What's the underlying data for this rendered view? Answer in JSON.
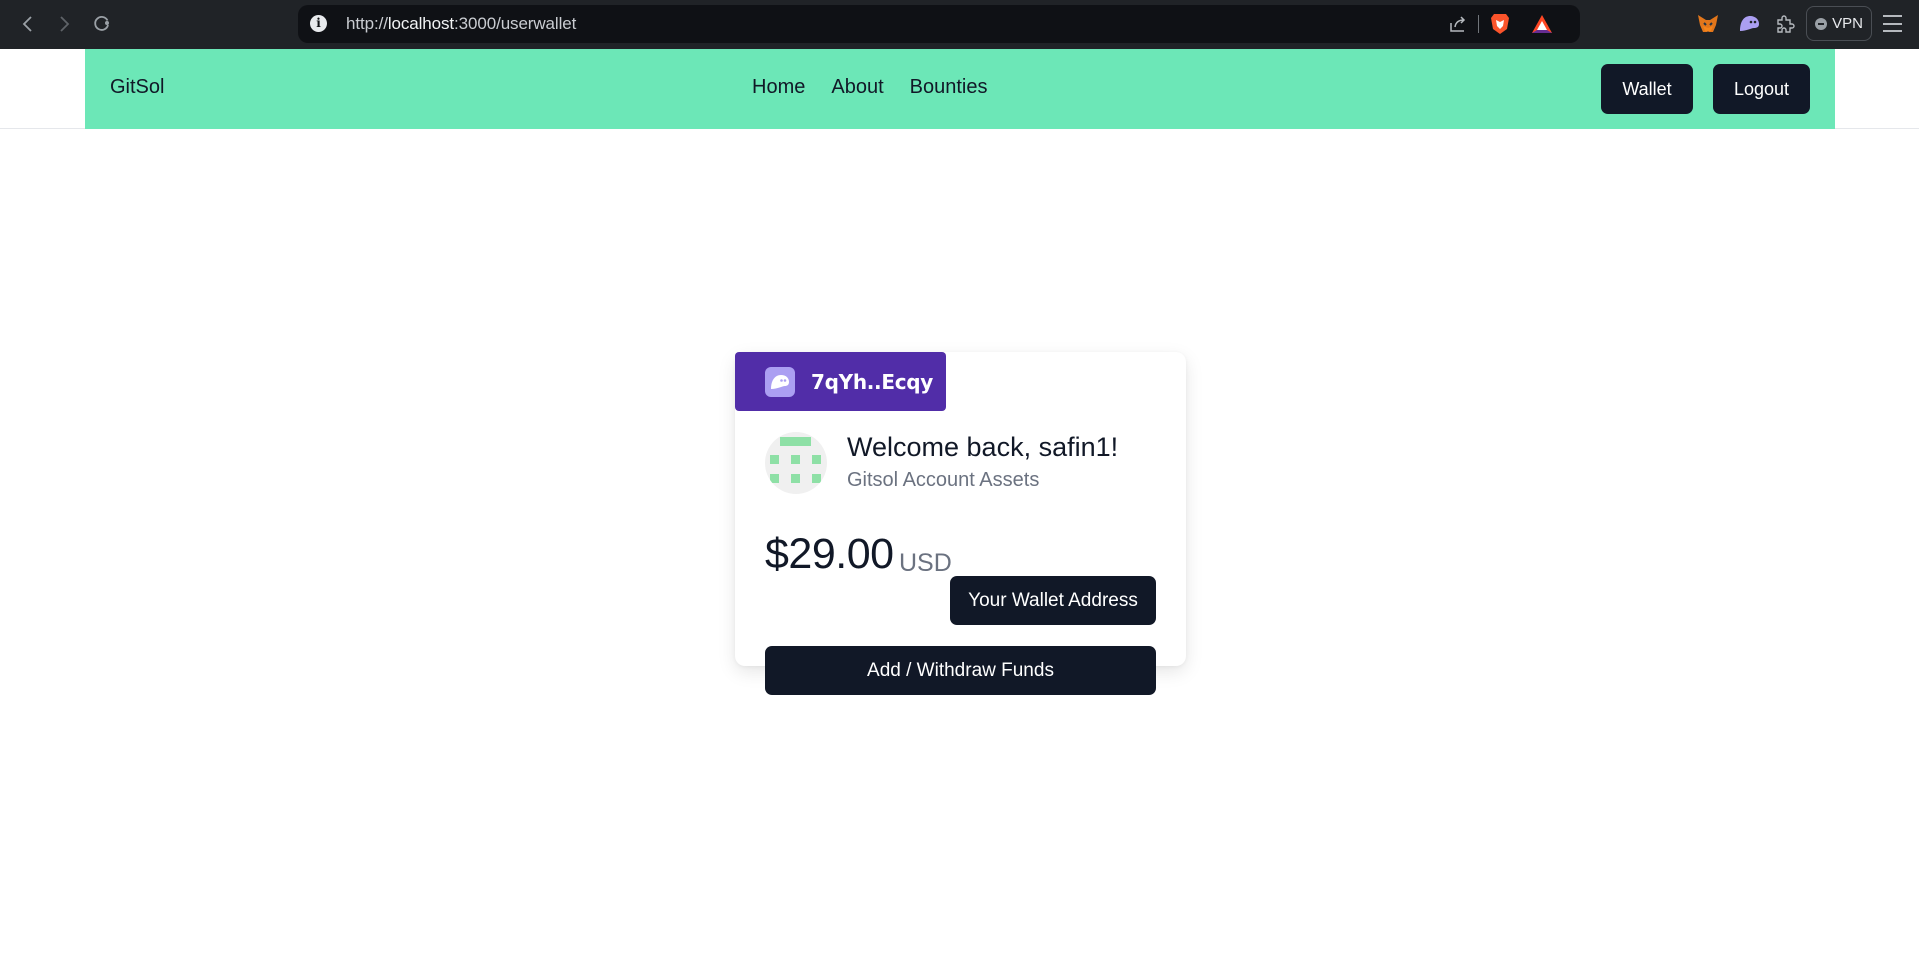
{
  "browser": {
    "url_scheme": "http://",
    "url_host": "localhost",
    "url_path": ":3000/userwallet",
    "vpn_label": "VPN",
    "icons": [
      "back-icon",
      "forward-icon",
      "reload-icon",
      "site-info-icon",
      "share-icon",
      "brave-shields-icon",
      "brave-rewards-icon",
      "metamask-extension-icon",
      "phantom-extension-icon",
      "extensions-puzzle-icon",
      "vpn-icon",
      "menu-icon"
    ]
  },
  "navbar": {
    "brand": "GitSol",
    "links": [
      {
        "label": "Home"
      },
      {
        "label": "About"
      },
      {
        "label": "Bounties"
      }
    ],
    "wallet_button": "Wallet",
    "logout_button": "Logout",
    "background_color": "#6ce7b7"
  },
  "card": {
    "phantom_address": "7qYh..Ecqy",
    "phantom_color": "#512da8",
    "welcome": "Welcome back, safin1!",
    "subtitle": "Gitsol Account Assets",
    "balance": "$29.00",
    "currency": "USD",
    "wallet_address_button": "Your Wallet Address",
    "funds_button": "Add / Withdraw Funds",
    "button_color": "#111827"
  }
}
